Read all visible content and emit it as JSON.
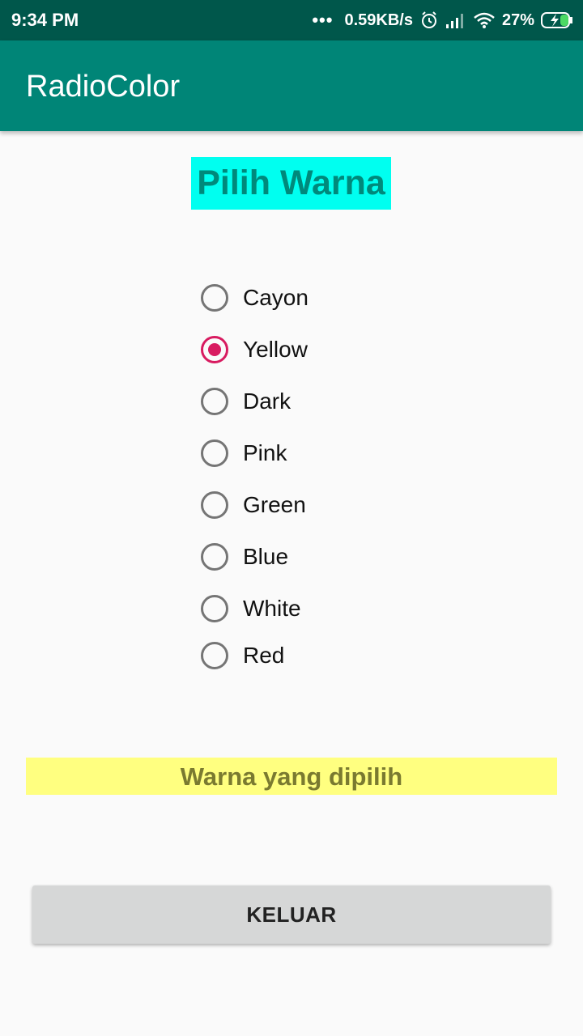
{
  "status_bar": {
    "time": "9:34 PM",
    "more": "•••",
    "net_speed": "0.59KB/s",
    "battery": "27%",
    "icons": [
      "alarm-icon",
      "signal-icon",
      "wifi-icon",
      "battery-charging-icon"
    ]
  },
  "app_bar": {
    "title": "RadioColor"
  },
  "heading": "Pilih Warna",
  "radio_group": {
    "selected": "Yellow",
    "options": [
      {
        "label": "Cayon",
        "checked": false
      },
      {
        "label": "Yellow",
        "checked": true
      },
      {
        "label": "Dark",
        "checked": false
      },
      {
        "label": "Pink",
        "checked": false
      },
      {
        "label": "Green",
        "checked": false
      },
      {
        "label": "Blue",
        "checked": false
      },
      {
        "label": "White",
        "checked": false
      },
      {
        "label": "Red",
        "checked": false
      }
    ]
  },
  "result_label": "Warna yang dipilih",
  "exit_button": "KELUAR",
  "colors": {
    "status_bar": "#00574b",
    "app_bar": "#008577",
    "heading_bg": "#00fff0",
    "heading_text": "#00897b",
    "radio_accent": "#d81b60",
    "result_bg": "#ffff80",
    "button_bg": "#d6d7d7"
  }
}
